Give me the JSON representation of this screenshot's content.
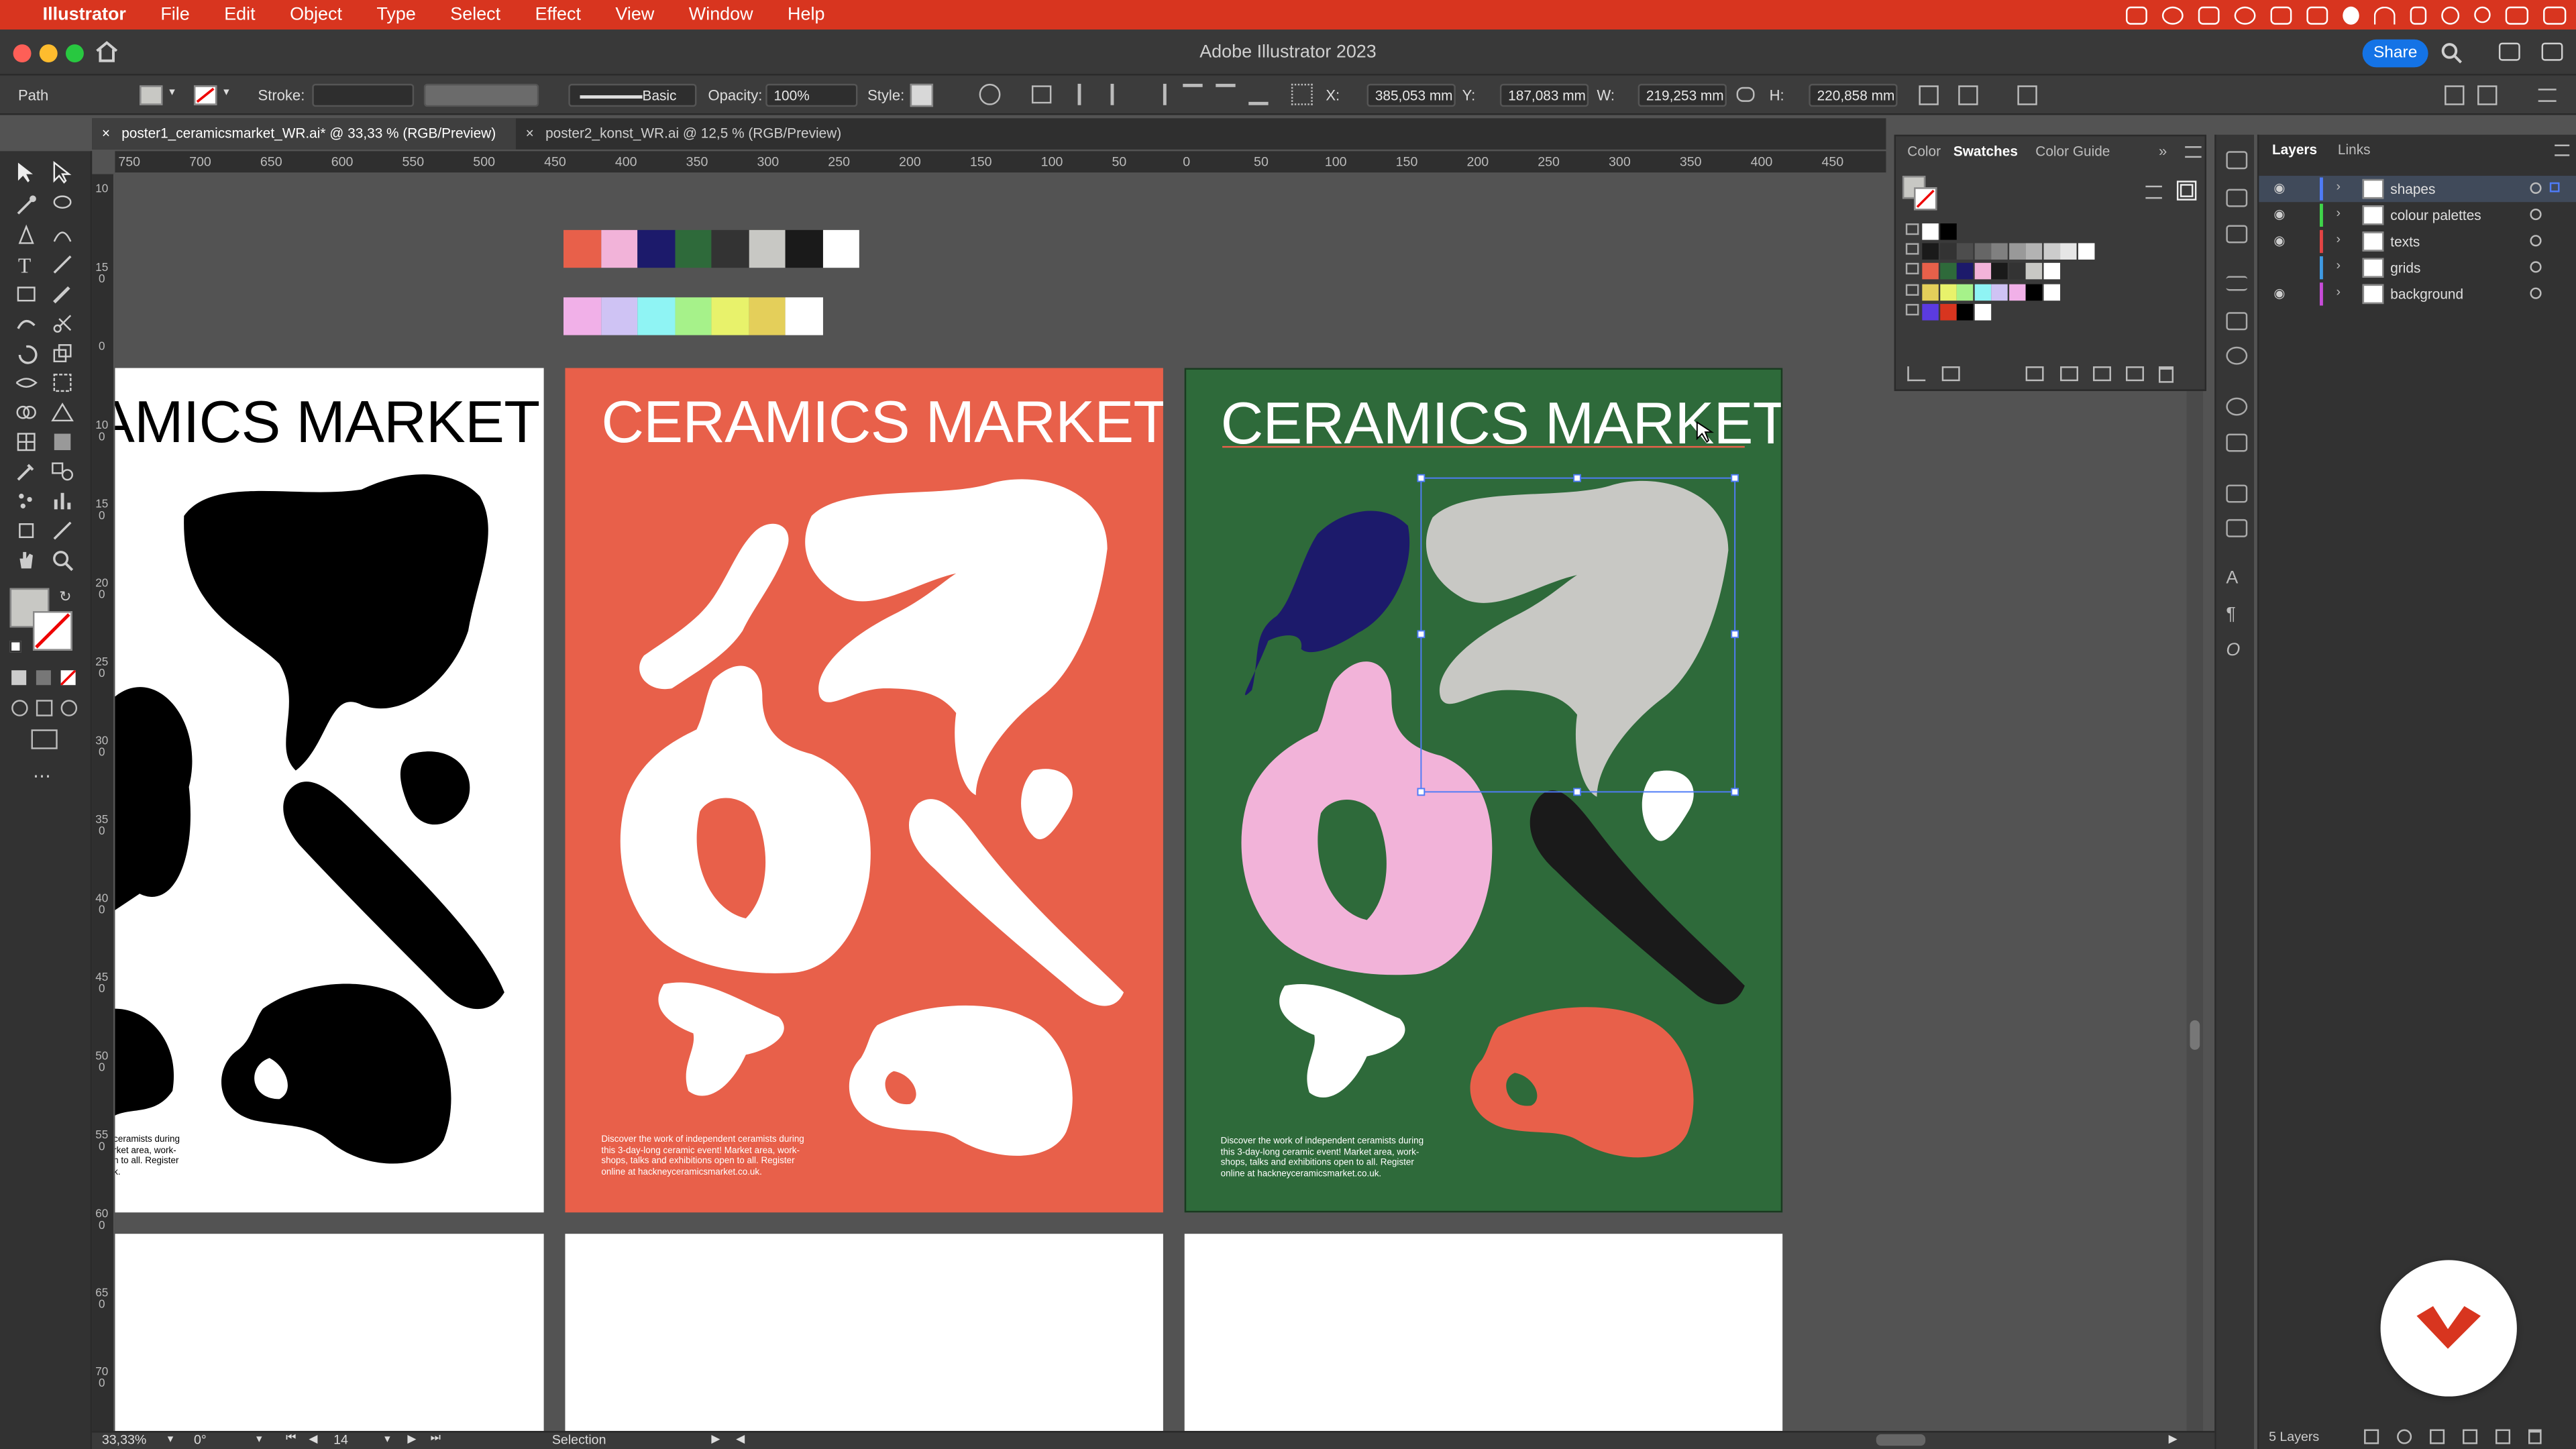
{
  "menubar": {
    "app_name": "Illustrator",
    "items": [
      "File",
      "Edit",
      "Object",
      "Type",
      "Select",
      "Effect",
      "View",
      "Window",
      "Help"
    ]
  },
  "window": {
    "title": "Adobe Illustrator 2023",
    "share_label": "Share"
  },
  "control_bar": {
    "selection_type": "Path",
    "stroke_label": "Stroke:",
    "brush_label": "Basic",
    "opacity_label": "Opacity:",
    "opacity_value": "100%",
    "style_label": "Style:",
    "x_label": "X:",
    "x_value": "385,053 mm",
    "y_label": "Y:",
    "y_value": "187,083 mm",
    "w_label": "W:",
    "w_value": "219,253 mm",
    "h_label": "H:",
    "h_value": "220,858 mm"
  },
  "tabs": [
    {
      "label": "poster1_ceramicsmarket_WR.ai* @ 33,33 % (RGB/Preview)",
      "active": true
    },
    {
      "label": "poster2_konst_WR.ai @ 12,5 % (RGB/Preview)",
      "active": false
    }
  ],
  "ruler": {
    "h_ticks": [
      "750",
      "700",
      "650",
      "600",
      "550",
      "500",
      "450",
      "400",
      "350",
      "300",
      "250",
      "200",
      "150",
      "100",
      "50",
      "0",
      "50",
      "100",
      "150",
      "200",
      "250",
      "300",
      "350",
      "400",
      "450"
    ],
    "v_ticks": [
      "1 0",
      "1 5 0",
      "0",
      "1 0 0",
      "1 5 0",
      "2 0 0",
      "2 5 0",
      "3 0 0",
      "3 5 0",
      "4 0 0",
      "4 5 0",
      "5 0 0",
      "5 5 0",
      "6 0 0",
      "6 5 0",
      "7 0 0"
    ]
  },
  "palettes": {
    "row1": [
      "#e8604a",
      "#f2b3d9",
      "#1c1a6b",
      "#2e6a3a",
      "#333333",
      "#c8c8c4",
      "#1a1a1a",
      "#ffffff"
    ],
    "row2": [
      "#f1b0e8",
      "#cfc3f4",
      "#8ff4f4",
      "#a6f28a",
      "#e8f26b",
      "#e4cf5a",
      "#ffffff"
    ]
  },
  "posters": [
    {
      "title": "AMICS MARKET",
      "body": "t ceramists during\narket area, work-\nen to all. Register\nuk.",
      "bg": "#ffffff",
      "fg": "#000000"
    },
    {
      "title": "CERAMICS MARKET",
      "body": "Discover the work of independent ceramists during\nthis 3-day-long ceramic event! Market area, work-\nshops, talks and exhibitions open to all. Register\nonline at hackneyceramicsmarket.co.uk.",
      "bg": "#e8604a",
      "fg": "#ffffff"
    },
    {
      "title": "CERAMICS MARKET",
      "body": "Discover the work of independent ceramists during\nthis 3-day-long ceramic event! Market area, work-\nshops, talks and exhibitions open to all. Register\nonline at hackneyceramicsmarket.co.uk.",
      "bg": "#2e6a3a",
      "fg": "#ffffff"
    }
  ],
  "swatches_panel": {
    "tabs": [
      "Color",
      "Swatches",
      "Color Guide"
    ],
    "rows": [
      [
        "#ffffff",
        "#000000"
      ],
      [
        "#1a1a1a",
        "#333333",
        "#4d4d4d",
        "#666666",
        "#808080",
        "#999999",
        "#b3b3b3",
        "#cccccc",
        "#e6e6e6",
        "#ffffff"
      ],
      [
        "#e8604a",
        "#2e6a3a",
        "#1c1a6b",
        "#f2b3d9",
        "#1a1a1a",
        "#333333",
        "#c8c8c4",
        "#ffffff"
      ],
      [
        "#e4cf5a",
        "#e8f26b",
        "#a6f28a",
        "#8ff4f4",
        "#cfc3f4",
        "#f1b0e8",
        "#000000",
        "#ffffff"
      ],
      [
        "#5b3be0",
        "#d8351f",
        "#000000",
        "#ffffff"
      ]
    ]
  },
  "layers_panel": {
    "tabs": [
      "Layers",
      "Links"
    ],
    "layers": [
      {
        "name": "shapes",
        "color": "#4f7cf7",
        "visible": true,
        "selected": true
      },
      {
        "name": "colour palettes",
        "color": "#3fd44a",
        "visible": true,
        "selected": false
      },
      {
        "name": "texts",
        "color": "#e34444",
        "visible": true,
        "selected": false
      },
      {
        "name": "grids",
        "color": "#3f9ae3",
        "visible": false,
        "selected": false
      },
      {
        "name": "background",
        "color": "#c74cd8",
        "visible": true,
        "selected": false
      }
    ],
    "footer": "5 Layers"
  },
  "status": {
    "zoom": "33,33%",
    "rotation": "0°",
    "artboard": "14",
    "tool": "Selection"
  }
}
